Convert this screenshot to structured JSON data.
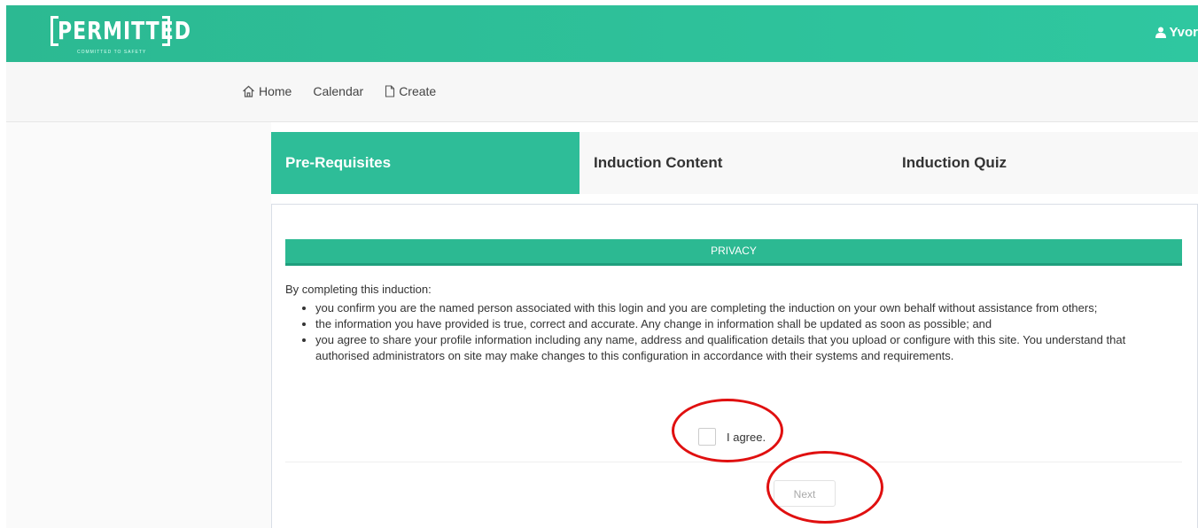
{
  "header": {
    "logo_text": "PERMITTED",
    "logo_tagline": "COMMITTED TO SAFETY",
    "user_name": "Yvor",
    "user_icon": "user-icon",
    "brand_color": "#2ebd98"
  },
  "nav": {
    "items": [
      {
        "label": "Home",
        "icon": "home-icon"
      },
      {
        "label": "Calendar"
      },
      {
        "label": "Create",
        "icon": "document-icon"
      }
    ]
  },
  "tabs": [
    {
      "label": "Pre-Requisites",
      "active": true
    },
    {
      "label": "Induction Content",
      "active": false
    },
    {
      "label": "Induction Quiz",
      "active": false
    }
  ],
  "privacy": {
    "heading": "PRIVACY",
    "intro": "By completing this induction:",
    "bullets": [
      "you confirm you are the named person associated with this login and you are completing the induction on your own behalf without assistance from others;",
      "the information you have provided is true, correct and accurate. Any change in information shall be updated as soon as possible; and",
      "you agree to share your profile information including any name, address and qualification details that you upload or configure with this site. You understand that authorised administrators on site may make changes to this configuration in accordance with their systems and requirements."
    ],
    "agree_label": "I agree.",
    "agree_checked": false,
    "next_label": "Next"
  },
  "annotation_color": "#e01010"
}
